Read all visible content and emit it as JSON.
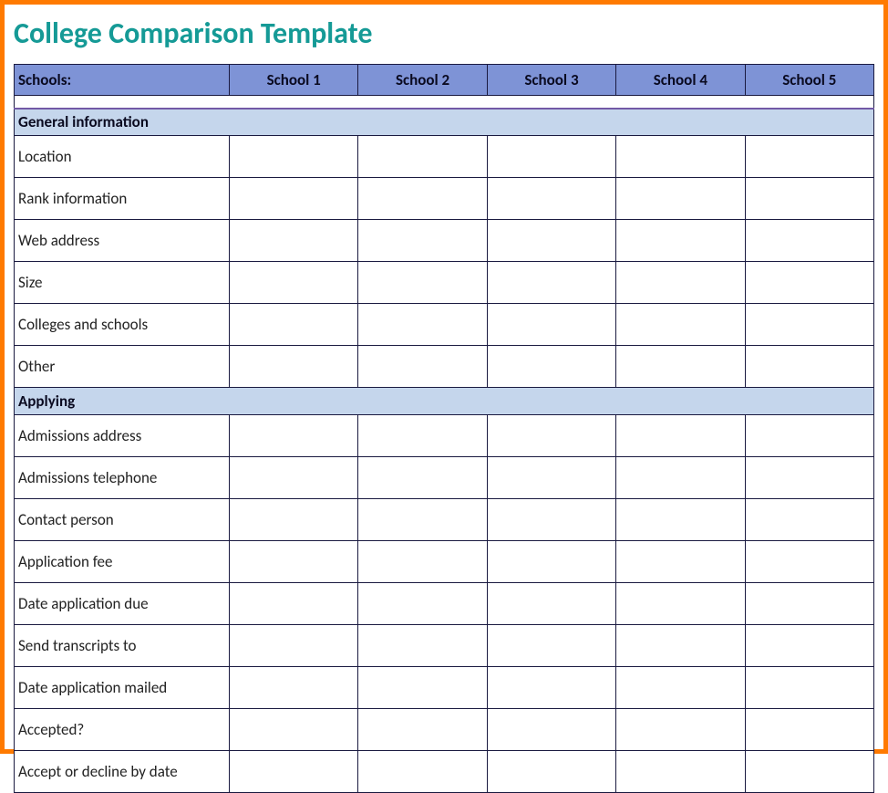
{
  "title": "College Comparison Template",
  "header": {
    "label": "Schools:",
    "schools": [
      "School 1",
      "School 2",
      "School 3",
      "School 4",
      "School 5"
    ]
  },
  "sections": [
    {
      "title": "General information",
      "rows": [
        "Location",
        "Rank information",
        "Web address",
        "Size",
        "Colleges and schools",
        "Other"
      ]
    },
    {
      "title": "Applying",
      "rows": [
        "Admissions address",
        "Admissions telephone",
        "Contact person",
        "Application fee",
        "Date application due",
        "Send transcripts to",
        "Date application mailed",
        "Accepted?",
        "Accept or decline by date"
      ]
    }
  ]
}
